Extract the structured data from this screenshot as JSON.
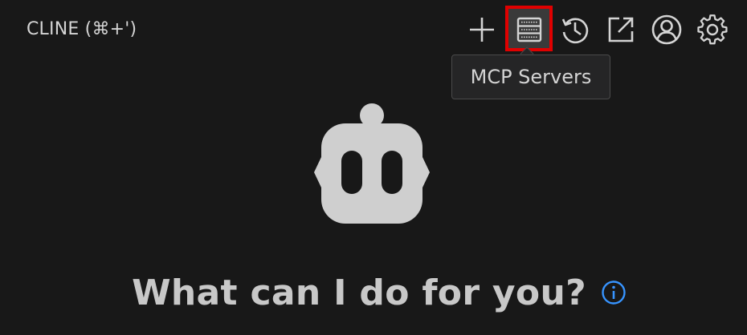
{
  "header": {
    "title": "CLINE (⌘+')"
  },
  "toolbar": {
    "buttons": [
      {
        "name": "new-task",
        "icon": "plus-icon"
      },
      {
        "name": "mcp-servers",
        "icon": "server-icon",
        "active": true
      },
      {
        "name": "history",
        "icon": "history-icon"
      },
      {
        "name": "open-in-editor",
        "icon": "external-link-icon"
      },
      {
        "name": "account",
        "icon": "user-circle-icon"
      },
      {
        "name": "settings",
        "icon": "gear-icon"
      }
    ]
  },
  "tooltip": {
    "text": "MCP Servers"
  },
  "main": {
    "heading": "What can I do for you?",
    "info_icon": "info-icon"
  },
  "colors": {
    "background": "#181818",
    "icon": "#d4d4d4",
    "highlight": "#e00000",
    "info": "#3794ff"
  }
}
